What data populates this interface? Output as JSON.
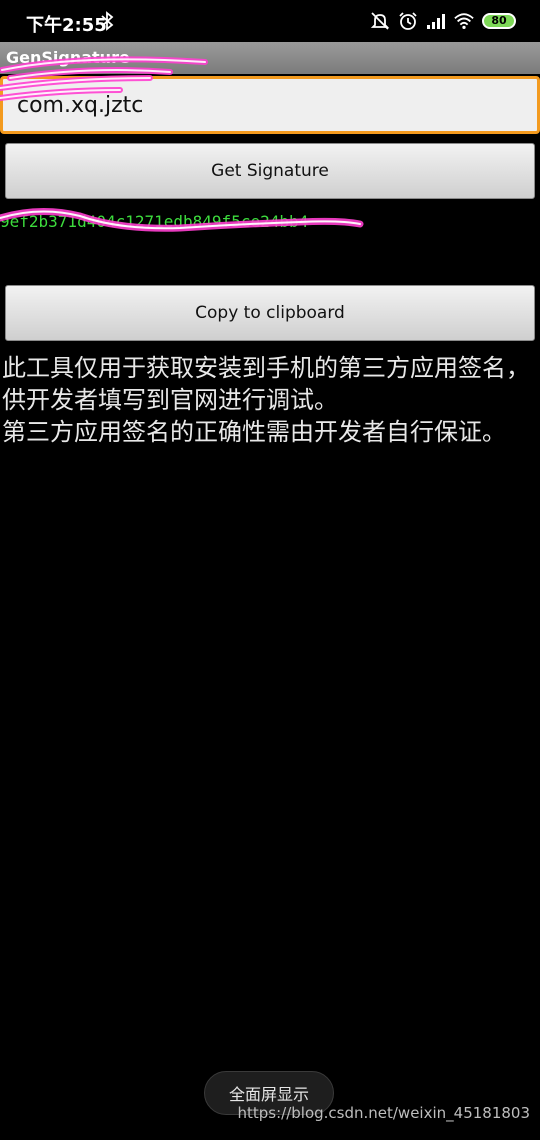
{
  "status_bar": {
    "time": "下午2:55",
    "battery_level": "80",
    "icons": [
      "bluetooth-icon",
      "mute-icon",
      "alarm-icon",
      "signal-icon",
      "wifi-icon",
      "battery-icon"
    ]
  },
  "app": {
    "title": "GenSignature"
  },
  "input": {
    "value": "com.xq.jztc"
  },
  "buttons": {
    "get_signature": "Get Signature",
    "copy_clipboard": "Copy to clipboard"
  },
  "result": {
    "signature": "9ef2b371d404c1271edb849f5ce24bb4"
  },
  "description": {
    "line1": "此工具仅用于获取安装到手机的第三方应用签名，供开发者填写到官网进行调试。",
    "line2": "第三方应用签名的正确性需由开发者自行保证。"
  },
  "toast": {
    "text": "全面屏显示"
  },
  "watermark": {
    "text": "https://blog.csdn.net/weixin_45181803"
  },
  "colors": {
    "accent": "#f39a1e",
    "signature_text": "#3ddc3d",
    "scribble": "#ff3fd0"
  }
}
